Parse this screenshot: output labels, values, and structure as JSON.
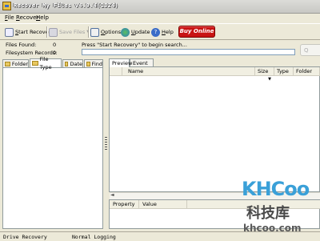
{
  "window": {
    "title": "Recover My Files v4.9.4(1324)"
  },
  "menu": [
    {
      "accel": "F",
      "rest": "ile"
    },
    {
      "accel": "R",
      "rest": "ecover"
    },
    {
      "accel": "H",
      "rest": "elp"
    }
  ],
  "toolbar": {
    "start_recovery": {
      "accel": "S",
      "rest": "tart Recovery"
    },
    "save_files": "Save Files",
    "options": {
      "accel": "O",
      "rest": "ptions"
    },
    "update": {
      "accel": "U",
      "rest": "pdate"
    },
    "help": {
      "accel": "H",
      "rest": "elp"
    },
    "buy_online": "Buy Online"
  },
  "stats": {
    "files_found_label": "Files Found:",
    "files_found_value": "0",
    "fs_records_label": "Filesystem Records:",
    "fs_records_value": "0"
  },
  "status": {
    "message": "Press \"Start Recovery\" to begin search...",
    "progress": 0
  },
  "scan_button": "Q",
  "left_tabs": [
    "Folder",
    "File Type",
    "Date",
    "Find"
  ],
  "right_tabs": [
    "Preview",
    "Event Log"
  ],
  "file_columns": [
    "Name",
    "Size",
    "Type",
    "Folder"
  ],
  "property_columns": [
    "Property",
    "Value"
  ],
  "statusbar": {
    "mode": "Drive Recovery",
    "logging": "Normal Logging"
  },
  "watermark": {
    "logo": "KHCoo",
    "cn": "科技库",
    "url": "khcoo.com"
  }
}
